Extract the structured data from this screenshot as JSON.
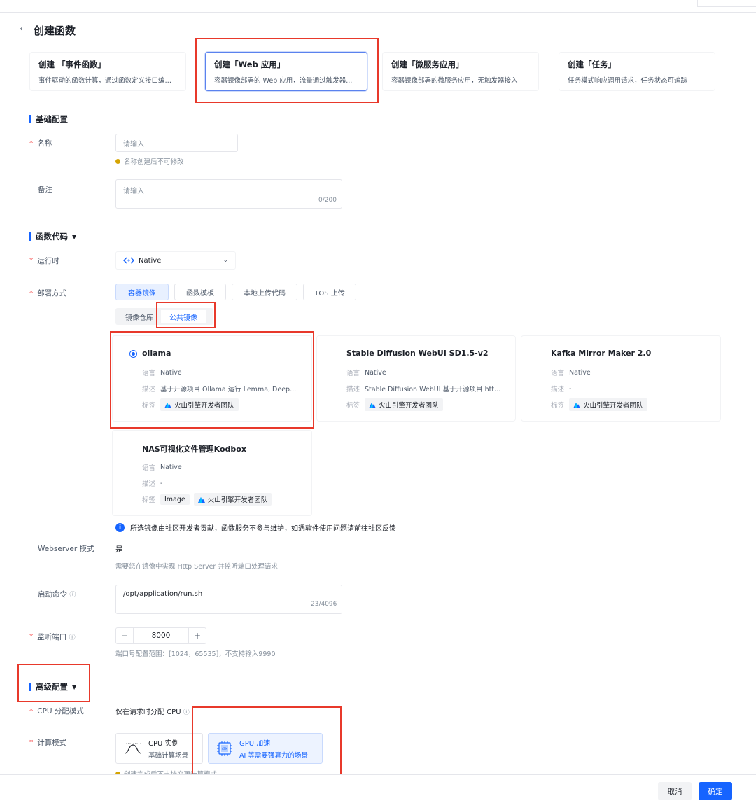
{
  "header": {
    "back_icon": "chevron-left-icon",
    "title": "创建函数"
  },
  "function_types": [
    {
      "title": "创建 「事件函数」",
      "desc": "事件驱动的函数计算，通过函数定义接口编写..."
    },
    {
      "title": "创建「Web 应用」",
      "desc": "容器镜像部署的 Web 应用，流量通过触发器..."
    },
    {
      "title": "创建「微服务应用」",
      "desc": "容器镜像部署的微服务应用，无触发器接入"
    },
    {
      "title": "创建「任务」",
      "desc": "任务模式响应调用请求，任务状态可追踪"
    }
  ],
  "basic": {
    "section_title": "基础配置",
    "name_label": "名称",
    "name_placeholder": "请输入",
    "name_hint": "名称创建后不可修改",
    "remark_label": "备注",
    "remark_placeholder": "请输入",
    "remark_counter": "0/200"
  },
  "code": {
    "section_title": "函数代码",
    "runtime_label": "运行时",
    "runtime_value": "Native",
    "deploy_label": "部署方式",
    "deploy_tabs": [
      "容器镜像",
      "函数模板",
      "本地上传代码",
      "TOS 上传"
    ],
    "source_tabs": [
      "镜像仓库",
      "公共镜像"
    ],
    "meta_keys": {
      "lang": "语言",
      "desc": "描述",
      "tags": "标签"
    },
    "images": [
      {
        "name": "ollama",
        "lang": "Native",
        "desc": "基于开源项目 Ollama 运行 Lemma, Deep...",
        "tags": [
          "火山引擎开发者团队"
        ],
        "selected": true
      },
      {
        "name": "Stable Diffusion WebUI SD1.5-v2",
        "lang": "Native",
        "desc": "Stable Diffusion WebUI 基于开源项目 htt...",
        "tags": [
          "火山引擎开发者团队"
        ],
        "selected": false
      },
      {
        "name": "Kafka Mirror Maker 2.0",
        "lang": "Native",
        "desc": "-",
        "tags": [
          "火山引擎开发者团队"
        ],
        "selected": false
      },
      {
        "name": "NAS可视化文件管理Kodbox",
        "lang": "Native",
        "desc": "-",
        "tags": [
          "Image",
          "火山引擎开发者团队"
        ],
        "selected": false
      }
    ],
    "notice": "所选镜像由社区开发者贡献，函数服务不参与维护，如遇软件使用问题请前往社区反馈",
    "webserver_label": "Webserver 模式",
    "webserver_value": "是",
    "webserver_hint": "需要您在镜像中实现 Http Server 并监听端口处理请求",
    "cmd_label": "启动命令",
    "cmd_value": "/opt/application/run.sh",
    "cmd_counter": "23/4096",
    "port_label": "监听端口",
    "port_value": "8000",
    "port_hint": "端口号配置范围：[1024，65535]，不支持输入9990"
  },
  "advanced": {
    "section_title": "高级配置",
    "cpu_label": "CPU 分配模式",
    "cpu_value": "仅在请求时分配 CPU",
    "compute_label": "计算模式",
    "modes": [
      {
        "title": "CPU 实例",
        "desc": "基础计算场景",
        "selected": false
      },
      {
        "title": "GPU 加速",
        "desc": "AI 等需要强算力的场景",
        "selected": true
      }
    ],
    "compute_hint": "创建完成后不支持变更计算模式"
  },
  "footer": {
    "cancel": "取消",
    "confirm": "确定"
  },
  "colors": {
    "primary": "#1664ff",
    "highlight": "#e8392b",
    "required": "#f53f3f"
  }
}
